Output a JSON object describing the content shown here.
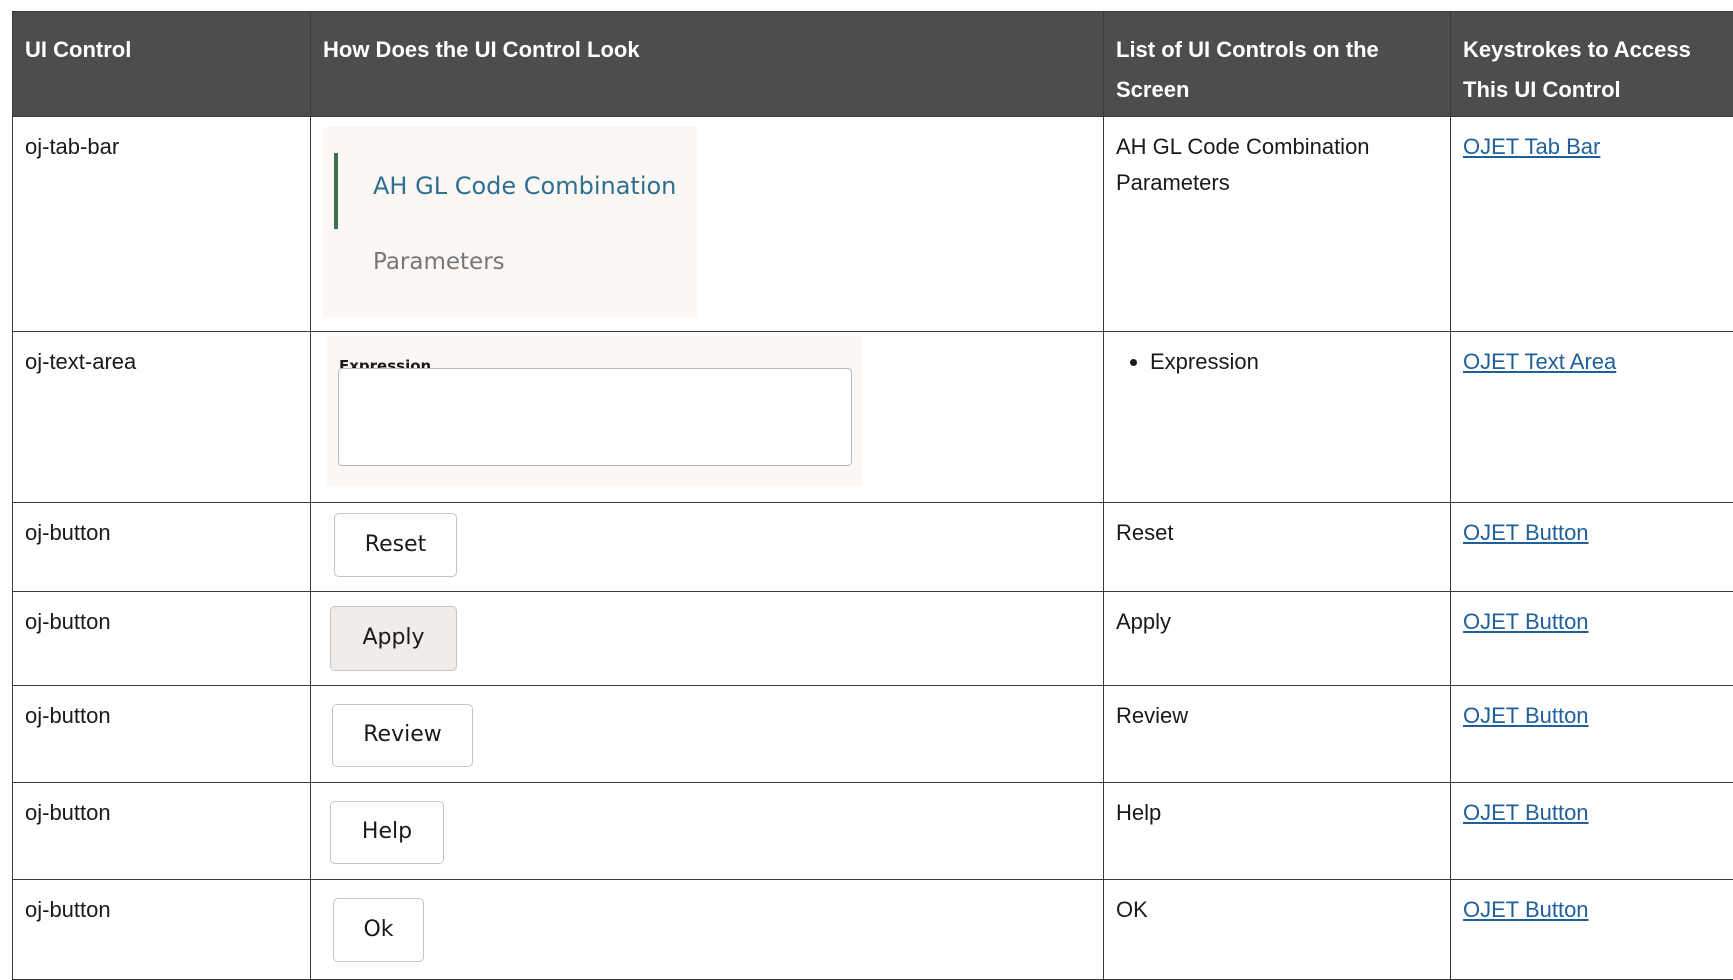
{
  "headers": {
    "col1": "UI Control",
    "col2": "How Does the UI Control Look",
    "col3": "List of UI Controls on the Screen",
    "col4": "Keystrokes to Access This UI Control"
  },
  "rows": [
    {
      "control": "oj-tab-bar",
      "sample": {
        "type": "tab-bar",
        "tabs": [
          "AH GL Code Combination",
          "Parameters"
        ]
      },
      "list": "AH GL Code Combination Parameters",
      "link": "OJET Tab Bar"
    },
    {
      "control": "oj-text-area",
      "sample": {
        "type": "text-area",
        "label": "Expression"
      },
      "list_items": [
        "Expression"
      ],
      "link": "OJET Text Area"
    },
    {
      "control": "oj-button",
      "sample": {
        "type": "button",
        "label": "Reset"
      },
      "list": "Reset",
      "link": "OJET Button"
    },
    {
      "control": "oj-button",
      "sample": {
        "type": "button",
        "label": "Apply"
      },
      "list": "Apply",
      "link": "OJET Button"
    },
    {
      "control": "oj-button",
      "sample": {
        "type": "button",
        "label": "Review"
      },
      "list": "Review",
      "link": "OJET Button"
    },
    {
      "control": "oj-button",
      "sample": {
        "type": "button",
        "label": "Help"
      },
      "list": "Help",
      "link": "OJET Button"
    },
    {
      "control": "oj-button",
      "sample": {
        "type": "button",
        "label": "Ok"
      },
      "list": "OK",
      "link": "OJET Button"
    }
  ],
  "colors": {
    "header_bg": "#4d4d4d",
    "link": "#1f5f9a",
    "tab_active": "#2f6f8f",
    "tab_indicator": "#3f6f4b"
  }
}
